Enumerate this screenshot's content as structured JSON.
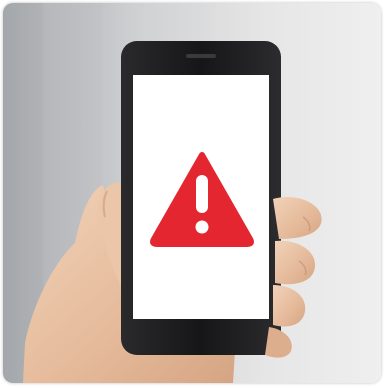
{
  "photo": {
    "subject": "hand-holding-smartphone",
    "screen_icon": "warning-triangle-icon",
    "colors": {
      "background_left": "#a9abaf",
      "background_right": "#ebebeb",
      "phone_body": "#1d1d1f",
      "screen": "#ffffff",
      "warning_red": "#e3262f",
      "exclamation": "#ffffff",
      "skin": "#e8c1a4"
    }
  }
}
